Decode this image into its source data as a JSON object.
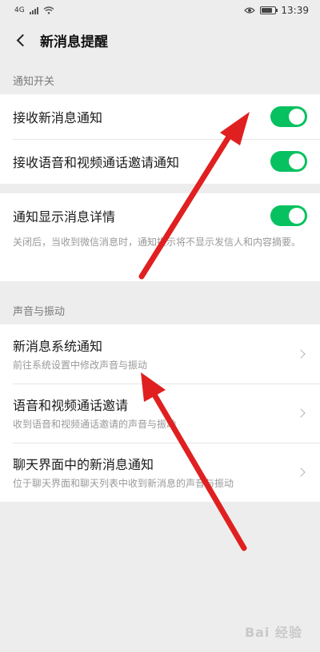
{
  "status_bar": {
    "network": "4G",
    "time": "13:39",
    "battery_level": 0.8
  },
  "header": {
    "title": "新消息提醒"
  },
  "section_notify": {
    "title": "通知开关",
    "items": [
      {
        "label": "接收新消息通知",
        "on": true
      },
      {
        "label": "接收语音和视频通话邀请通知",
        "on": true
      }
    ]
  },
  "detail": {
    "label": "通知显示消息详情",
    "on": true,
    "desc": "关闭后，当收到微信消息时，通知提示将不显示发信人和内容摘要。"
  },
  "section_sound": {
    "title": "声音与振动",
    "items": [
      {
        "label": "新消息系统通知",
        "desc": "前往系统设置中修改声音与振动"
      },
      {
        "label": "语音和视频通话邀请",
        "desc": "收到语音和视频通话邀请的声音与振动"
      },
      {
        "label": "聊天界面中的新消息通知",
        "desc": "位于聊天界面和聊天列表中收到新消息的声音与振动"
      }
    ]
  },
  "watermark": "Bai 经验",
  "colors": {
    "toggle_on": "#07c160",
    "arrow": "#e02020",
    "background": "#ededed"
  }
}
